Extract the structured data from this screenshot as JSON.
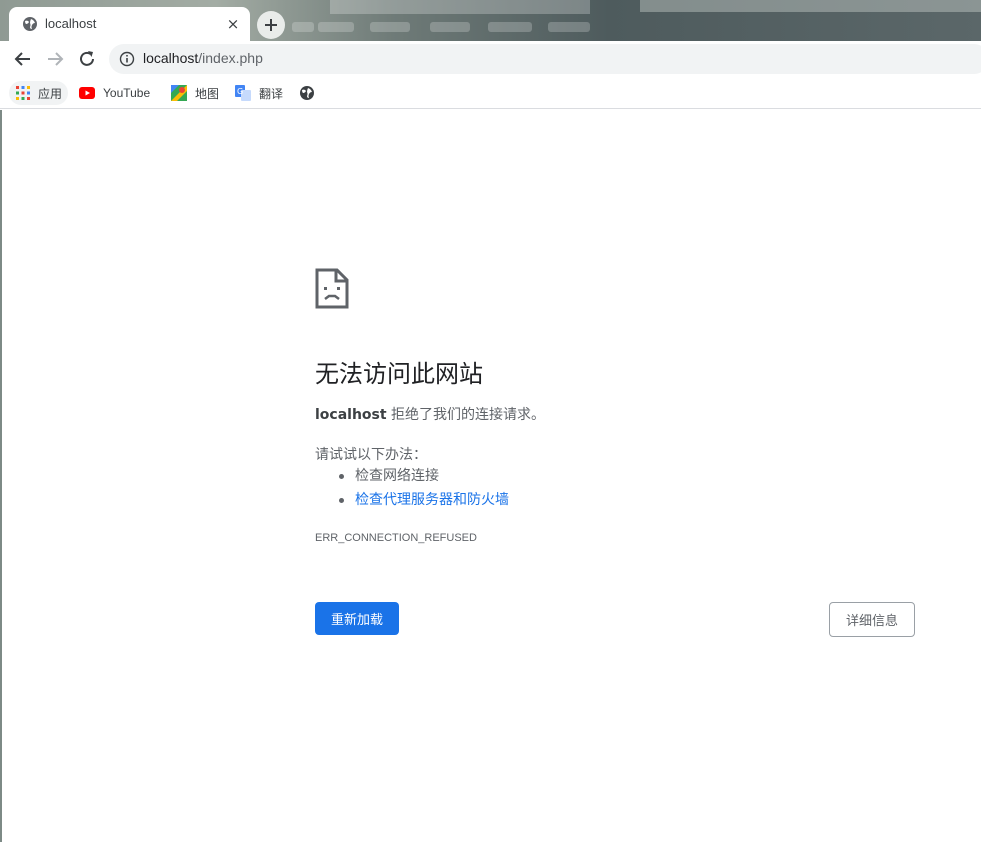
{
  "tab": {
    "title": "localhost",
    "close_glyph": "×",
    "favicon": "globe-icon"
  },
  "toolbar": {
    "back_icon": "arrow-left-icon",
    "forward_icon": "arrow-right-icon",
    "reload_icon": "reload-icon",
    "url_host": "localhost",
    "url_path": "/index.php"
  },
  "bookmarks": [
    {
      "label": "应用",
      "icon": "apps-grid-icon"
    },
    {
      "label": "YouTube",
      "icon": "youtube-icon"
    },
    {
      "label": "地图",
      "icon": "maps-icon"
    },
    {
      "label": "翻译",
      "icon": "translate-icon"
    },
    {
      "label": "",
      "icon": "globe-icon"
    }
  ],
  "error": {
    "icon": "sad-page-icon",
    "heading": "无法访问此网站",
    "host": "localhost",
    "summary_rest": " 拒绝了我们的连接请求。",
    "suggestions_title": "请试试以下办法：",
    "suggestions": [
      "检查网络连接",
      "检查代理服务器和防火墙"
    ],
    "code": "ERR_CONNECTION_REFUSED",
    "reload_label": "重新加载",
    "details_label": "详细信息"
  },
  "colors": {
    "accent": "#1a73e8",
    "text_secondary": "#5f6368"
  }
}
